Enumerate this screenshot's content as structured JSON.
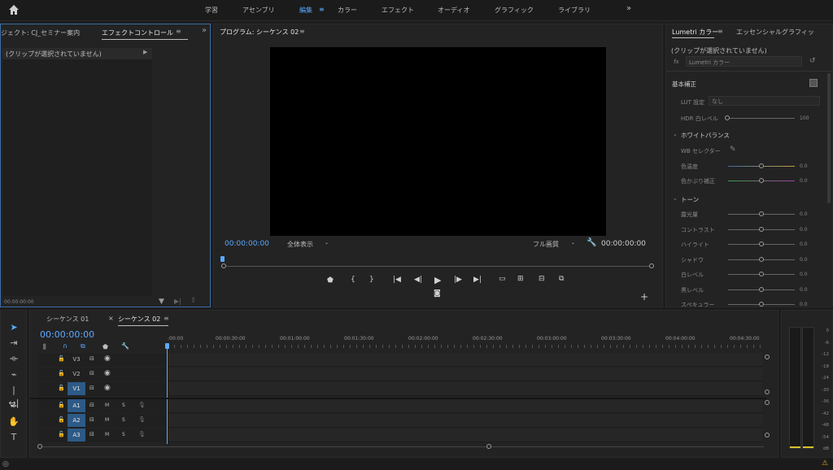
{
  "topbar": {
    "workspaces": [
      {
        "label": "学習",
        "active": false
      },
      {
        "label": "アセンブリ",
        "active": false
      },
      {
        "label": "編集",
        "active": true
      },
      {
        "label": "カラー",
        "active": false
      },
      {
        "label": "エフェクト",
        "active": false
      },
      {
        "label": "オーディオ",
        "active": false
      },
      {
        "label": "グラフィック",
        "active": false
      },
      {
        "label": "ライブラリ",
        "active": false
      }
    ],
    "more_icon": "»"
  },
  "left_panel": {
    "tab_project": "ジェクト: CJ_セミナー案内",
    "tab_effect": "エフェクトコントロール",
    "no_clip": "(クリップが選択されていません)",
    "timecode": "00:00:00:00"
  },
  "program": {
    "title": "プログラム: シーケンス 02",
    "timecode_left": "00:00:00:00",
    "fit_select": "全体表示",
    "quality_select": "フル画質",
    "timecode_right": "00:00:00:00"
  },
  "lumetri": {
    "tab_lumetri": "Lumetri カラー",
    "tab_essential": "エッセンシャルグラフィッ",
    "no_clip": "(クリップが選択されていません)",
    "fx_select": "Lumetri カラー",
    "section_basic": "基本補正",
    "lut_label": "LUT 設定",
    "lut_value": "なし",
    "hdr_label": "HDR 白レベル",
    "hdr_value": "100",
    "wb_section": "ホワイトバランス",
    "wb_selector": "WB セレクター",
    "temp_label": "色温度",
    "temp_value": "0.0",
    "tint_label": "色かぶり補正",
    "tint_value": "0.0",
    "tone_section": "トーン",
    "tone_rows": [
      {
        "label": "露光量",
        "value": "0.0"
      },
      {
        "label": "コントラスト",
        "value": "0.0"
      },
      {
        "label": "ハイライト",
        "value": "0.0"
      },
      {
        "label": "シャドウ",
        "value": "0.0"
      },
      {
        "label": "白レベル",
        "value": "0.0"
      },
      {
        "label": "黒レベル",
        "value": "0.0"
      },
      {
        "label": "スペキュラー",
        "value": "0.0"
      }
    ]
  },
  "timeline": {
    "tab_seq1": "シーケンス 01",
    "tab_seq2": "シーケンス 02",
    "timecode": "00:00:00:00",
    "ruler": [
      ":00:00",
      "00:00:30:00",
      "00:01:00:00",
      "00:01:30:00",
      "00:02:00:00",
      "00:02:30:00",
      "00:03:00:00",
      "00:03:30:00",
      "00:04:00:00",
      "00:04:30:00"
    ],
    "video_tracks": [
      "V3",
      "V2",
      "V1"
    ],
    "audio_tracks": [
      "A1",
      "A2",
      "A3"
    ],
    "mute": "M",
    "solo": "S"
  },
  "meter": {
    "labels": [
      "0",
      "-6",
      "-12",
      "-18",
      "-24",
      "-30",
      "-36",
      "-42",
      "-48",
      "-54",
      "dB"
    ]
  }
}
